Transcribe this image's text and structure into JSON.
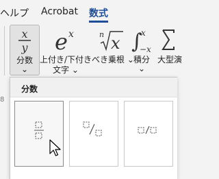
{
  "menu": {
    "tabs": [
      {
        "label": "ヘルプ"
      },
      {
        "label": "Acrobat"
      },
      {
        "label": "数式",
        "active": true
      }
    ]
  },
  "ribbon": {
    "buttons": [
      {
        "icon": "fraction-icon",
        "label": "分数",
        "sub": "⌄"
      },
      {
        "icon": "script-icon",
        "label": "上付き/下付き",
        "label2": "文字 ⌄"
      },
      {
        "icon": "radical-icon",
        "label": "べき乗根 ⌄"
      },
      {
        "icon": "integral-icon",
        "label": "積分",
        "sub": "⌄"
      },
      {
        "icon": "large-operator-icon",
        "label": "大型演"
      }
    ]
  },
  "panel": {
    "title": "分数",
    "items": [
      {
        "name": "stacked-fraction",
        "selected": true
      },
      {
        "name": "skewed-fraction"
      },
      {
        "name": "linear-fraction"
      }
    ]
  },
  "edge_label": "8",
  "colors": {
    "accent": "#1f4e96",
    "panel_bg": "#ffffff",
    "ribbon_bg": "#f3f3f3"
  }
}
